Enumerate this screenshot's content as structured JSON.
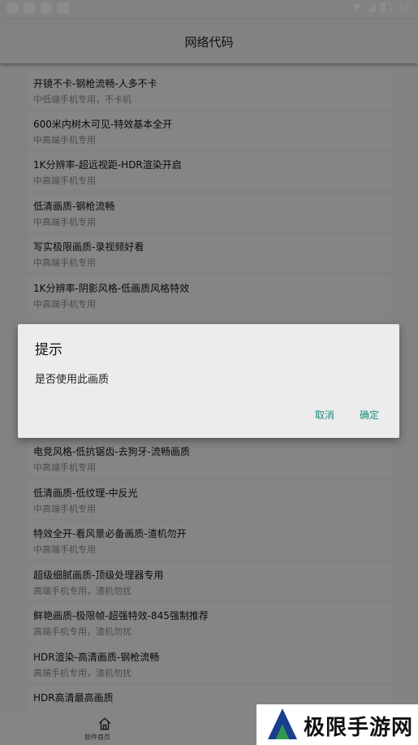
{
  "statusbar": {
    "time": "2:10"
  },
  "appbar": {
    "title": "网络代码"
  },
  "items": [
    {
      "title": "开镜不卡-钢枪流畅-人多不卡",
      "subtitle": "中低端手机专用，不卡机"
    },
    {
      "title": "600米内树木可见-特效基本全开",
      "subtitle": "中高端手机专用"
    },
    {
      "title": "1K分辨率-超远视距-HDR渲染开启",
      "subtitle": "中高端手机专用"
    },
    {
      "title": "低清画质-钢枪流畅",
      "subtitle": "中高端手机专用"
    },
    {
      "title": "写实极限画质-录视频好看",
      "subtitle": "中高端手机专用"
    },
    {
      "title": "1K分辨率-阴影风格-低画质风格特效",
      "subtitle": "中高端手机专用"
    },
    {
      "title": "电竞风格-低抗锯齿-去狗牙-流畅画质",
      "subtitle": "中高端手机专用"
    },
    {
      "title": "低清画质-低纹理-中反光",
      "subtitle": "中高端手机专用"
    },
    {
      "title": "特效全开-看风景必备画质-渣机勿开",
      "subtitle": "中高端手机专用"
    },
    {
      "title": "超级细腻画质-顶级处理器专用",
      "subtitle": "高端手机专用，渣机勿扰"
    },
    {
      "title": "鲜艳画质-极限帧-超强特效-845强制推荐",
      "subtitle": "高端手机专用，渣机勿扰"
    },
    {
      "title": "HDR渲染-高清画质-钢枪流畅",
      "subtitle": "高端手机专用，渣机勿扰"
    },
    {
      "title": "HDR高清最高画质",
      "subtitle": ""
    }
  ],
  "bottomnav": {
    "home_label": "软件首页"
  },
  "dialog": {
    "title": "提示",
    "message": "是否使用此画质",
    "cancel": "取消",
    "confirm": "确定"
  },
  "watermark": {
    "text": "极限手游网"
  },
  "colors": {
    "accent": "#1e8b7e",
    "logo_blue": "#1a3f8c",
    "logo_green": "#2e9a4a"
  }
}
